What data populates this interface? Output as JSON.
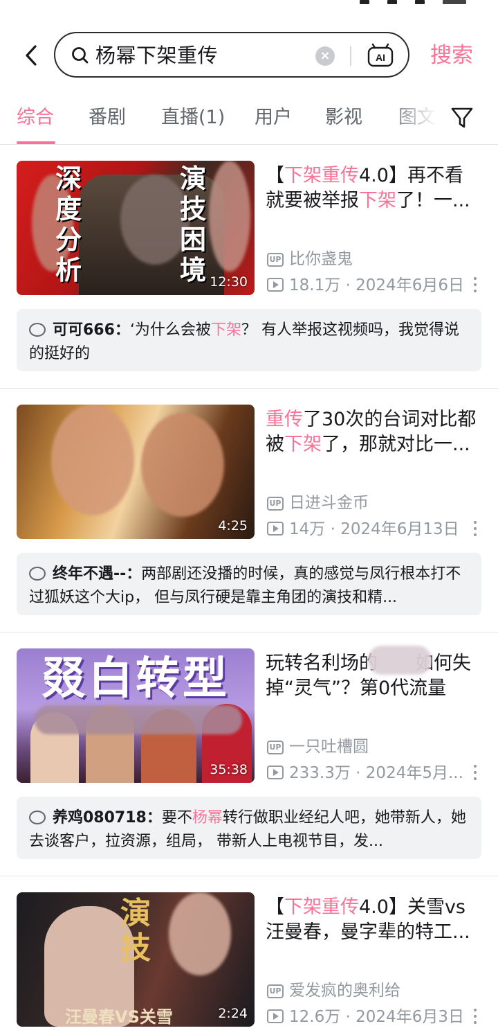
{
  "search": {
    "query": "杨幂下架重传",
    "submit_label": "搜索",
    "ai_label": "AI"
  },
  "tabs": [
    {
      "label": "综合",
      "active": true
    },
    {
      "label": "番剧",
      "active": false
    },
    {
      "label": "直播(1)",
      "active": false
    },
    {
      "label": "用户",
      "active": false
    },
    {
      "label": "影视",
      "active": false
    },
    {
      "label": "图文",
      "active": false
    }
  ],
  "results": [
    {
      "title_segments": [
        "【",
        "下架重传",
        "4.0】再不看就要被举报",
        "下架",
        "了！一..."
      ],
      "thumb_text_left": "深度分析",
      "thumb_text_right": "演技困境",
      "duration": "12:30",
      "uploader": "比你盏鬼",
      "views": "18.1万",
      "date": "2024年6月6日",
      "comment": {
        "user": "可可666：",
        "segments": [
          "‘为什么会被",
          "下架",
          "？ 有人举报这视频吗，我觉得说的挺好的"
        ]
      }
    },
    {
      "title_segments": [
        "",
        "重传",
        "了30次的台词对比都被",
        "下架",
        "了，那就对比一..."
      ],
      "duration": "4:25",
      "uploader": "日进斗金币",
      "views": "14万",
      "date": "2024年6月13日",
      "comment": {
        "user": "终年不遇--：",
        "segments": [
          "两部剧还没播的时候，真的感觉与凤行根本打不过狐妖这个大ip， 但与凤行硬是靠主角团的演技和精...",
          "",
          ""
        ]
      }
    },
    {
      "title_segments": [
        "",
        "",
        "玩转名利场的　　如何失掉“灵气”？第0代流量的...",
        "",
        ""
      ],
      "thumb_text_top": "叕白转型",
      "duration": "35:38",
      "uploader": "一只吐槽圆",
      "views": "233.3万",
      "date": "2024年5月...",
      "comment": {
        "user": "养鸡080718：",
        "segments": [
          "要不",
          "杨幂",
          "转行做职业经纪人吧，她带新人，她去谈客户，拉资源，组局， 带新人上电视节目，发..."
        ]
      }
    },
    {
      "title_segments": [
        "【",
        "下架重传",
        "4.0】关雪vs汪曼春，曼字辈的特工...",
        "",
        ""
      ],
      "thumb_text_top": "演技",
      "thumb_text_bottom": "汪曼春VS关雪",
      "duration": "2:24",
      "uploader": "爱发疯的奥利给",
      "views": "12.6万",
      "date": "2024年6月3日"
    }
  ],
  "colors": {
    "accent": "#fb7299",
    "meta": "#9499a0",
    "comment_bg": "#f1f2f3"
  },
  "icons": [
    "back-arrow-icon",
    "search-icon",
    "clear-icon",
    "ai-icon",
    "filter-icon",
    "up-badge-icon",
    "play-count-icon",
    "more-icon",
    "comment-icon"
  ]
}
